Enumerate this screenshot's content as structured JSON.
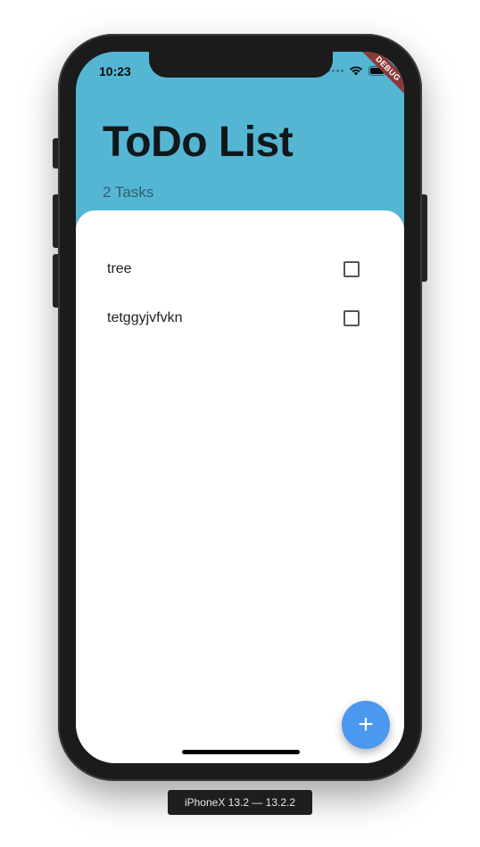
{
  "status_bar": {
    "time": "10:23",
    "debug_banner": "DEBUG"
  },
  "header": {
    "title": "ToDo List",
    "subtitle": "2 Tasks"
  },
  "tasks": [
    {
      "label": "tree",
      "checked": false
    },
    {
      "label": "tetggyjvfvkn",
      "checked": false
    }
  ],
  "fab": {
    "icon": "plus-icon",
    "glyph": "+"
  },
  "simulator": {
    "device_label": "iPhoneX 13.2 — 13.2.2"
  },
  "colors": {
    "header_bg": "#55b6d4",
    "fab_bg": "#4a98f0",
    "debug_ribbon": "#8b3a3a"
  }
}
